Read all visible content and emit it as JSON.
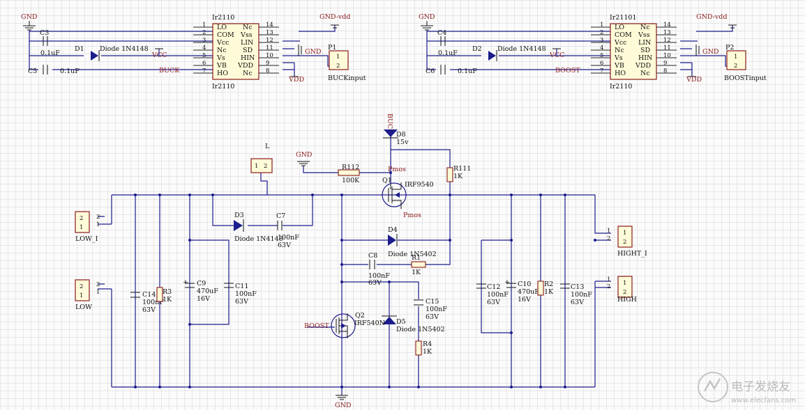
{
  "ic1": {
    "ref": "Ir2110",
    "ref_bottom": "Ir2110",
    "left_pins": [
      {
        "num": "1",
        "name": "LO"
      },
      {
        "num": "2",
        "name": "COM"
      },
      {
        "num": "3",
        "name": "Vcc"
      },
      {
        "num": "4",
        "name": "Nc"
      },
      {
        "num": "5",
        "name": "Vs"
      },
      {
        "num": "6",
        "name": "VB"
      },
      {
        "num": "7",
        "name": "HO"
      }
    ],
    "right_pins": [
      {
        "num": "14",
        "name": "Nc"
      },
      {
        "num": "13",
        "name": "Vss"
      },
      {
        "num": "12",
        "name": "LIN"
      },
      {
        "num": "11",
        "name": "SD"
      },
      {
        "num": "10",
        "name": "HIN"
      },
      {
        "num": "9",
        "name": "VDD"
      },
      {
        "num": "8",
        "name": "Nc"
      }
    ]
  },
  "ic2": {
    "ref": "Ir21101",
    "ref_bottom": "Ir2110",
    "left_pins": [
      {
        "num": "1",
        "name": "LO"
      },
      {
        "num": "2",
        "name": "COM"
      },
      {
        "num": "3",
        "name": "Vcc"
      },
      {
        "num": "4",
        "name": "Nc"
      },
      {
        "num": "5",
        "name": "Vs"
      },
      {
        "num": "6",
        "name": "VB"
      },
      {
        "num": "7",
        "name": "HO"
      }
    ],
    "right_pins": [
      {
        "num": "14",
        "name": "Nc"
      },
      {
        "num": "13",
        "name": "Vss"
      },
      {
        "num": "12",
        "name": "LIN"
      },
      {
        "num": "11",
        "name": "SD"
      },
      {
        "num": "10",
        "name": "HIN"
      },
      {
        "num": "9",
        "name": "VDD"
      },
      {
        "num": "8",
        "name": "Nc"
      }
    ]
  },
  "nets": {
    "gnd": "GND",
    "gnd_vdd": "GND-vdd",
    "vcc": "VCC",
    "vdd": "VDD",
    "buck": "BUCK",
    "boost": "BOOST",
    "buck_vertical": "BUCK",
    "pmos": "Pmos"
  },
  "parts": {
    "c3": "C3",
    "c4": "C4",
    "c5": "C5",
    "c6": "C6",
    "c3_val": "0.1uF",
    "c5_val": "0.1uF",
    "c4_val": "0.1uF",
    "c6_val": "0.1uF",
    "d1": "D1",
    "d1_val": "Diode 1N4148",
    "d2": "D2",
    "d2_val": "Diode 1N4148",
    "p1": "P1",
    "p1_val": "BUCKinput",
    "p2": "P2",
    "p2_val": "BOOSTinput",
    "l": "L",
    "d3": "D3",
    "d3_val": "Diode 1N4148",
    "c7": "C7",
    "c7_val": "100nF",
    "c7_v": "63V",
    "r112": "R112",
    "r112_val": "100K",
    "d8": "D8",
    "d8_val": "15v",
    "q1": "Q1",
    "q1_val": "IRF9540",
    "r111": "R111",
    "r111_val": "1K",
    "d4": "D4",
    "d4_val": "Diode 1N5402",
    "c8": "C8",
    "c8_val": "100nF",
    "c8_v": "63V",
    "r1": "R1",
    "r1_val": "1K",
    "c15": "C15",
    "c15_val": "100nF",
    "c15_v": "63V",
    "q2": "Q2",
    "q2_val": "IRF540N",
    "d5": "D5",
    "d5_val": "Diode 1N5402",
    "r4": "R4",
    "r4_val": "1K",
    "c14": "C14",
    "c14_val": "100nF",
    "c14_v": "63V",
    "r3": "R3",
    "r3_val": "1K",
    "c9": "C9",
    "c9_val": "470uF",
    "c9_v": "16V",
    "c11": "C11",
    "c11_val": "100nF",
    "c11_v": "63V",
    "c12": "C12",
    "c12_val": "100nF",
    "c12_v": "63V",
    "c10": "C10",
    "c10_val": "470uF",
    "c10_v": "16V",
    "r2": "R2",
    "r2_val": "1K",
    "c13": "C13",
    "c13_val": "100nF",
    "c13_v": "63V",
    "low_i": "LOW_I",
    "low": "LOW",
    "hight_i": "HIGHT_I",
    "high": "HIGH"
  },
  "watermark": {
    "cn": "电子发烧友",
    "url": "www.elecfans.com"
  }
}
